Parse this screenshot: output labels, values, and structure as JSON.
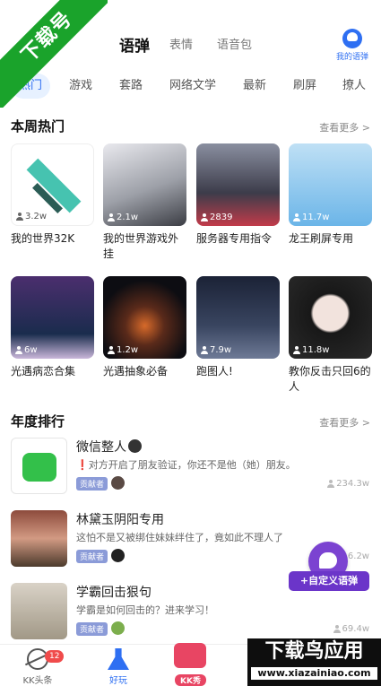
{
  "watermark": {
    "ribbon": "下载号",
    "brand": "下载鸟应用",
    "url": "www.xiazainiao.com"
  },
  "header": {
    "tabs": [
      {
        "label": "语弹"
      },
      {
        "label": "表情"
      },
      {
        "label": "语音包"
      }
    ],
    "mine_label": "我的语弹"
  },
  "categories": [
    {
      "label": "热门"
    },
    {
      "label": "游戏"
    },
    {
      "label": "套路"
    },
    {
      "label": "网络文学"
    },
    {
      "label": "最新"
    },
    {
      "label": "刷屏"
    },
    {
      "label": "撩人"
    }
  ],
  "weekly": {
    "title": "本周热门",
    "more": "查看更多 >",
    "cards": [
      {
        "count": "3.2w",
        "title": "我的世界32K"
      },
      {
        "count": "2.1w",
        "title": "我的世界游戏外挂"
      },
      {
        "count": "2839",
        "title": "服务器专用指令"
      },
      {
        "count": "11.7w",
        "title": "龙王刷屏专用"
      },
      {
        "count": "6w",
        "title": "光遇病恋合集"
      },
      {
        "count": "1.2w",
        "title": "光遇抽象必备"
      },
      {
        "count": "7.9w",
        "title": "跑图人!"
      },
      {
        "count": "11.8w",
        "title": "教你反击只回6的人"
      }
    ]
  },
  "yearly": {
    "title": "年度排行",
    "more": "查看更多 >",
    "items": [
      {
        "title": "微信整人",
        "mark": "❗",
        "desc": "对方开启了朋友验证，你还不是他（她）朋友。",
        "badge": "贡献者",
        "count": "234.3w"
      },
      {
        "title": "林黛玉阴阳专用",
        "mark": "",
        "desc": "这怕不是又被绑住妹妹绊住了，竟如此不理人了",
        "badge": "贡献者",
        "count": "6.2w"
      },
      {
        "title": "学霸回击狠句",
        "mark": "",
        "desc": "学霸是如何回击的？进来学习！",
        "badge": "贡献者",
        "count": "69.4w"
      }
    ]
  },
  "fab": {
    "label": "+自定义语弹"
  },
  "bottom_nav": {
    "items": [
      {
        "label": "KK头条"
      },
      {
        "label": "好玩"
      },
      {
        "label": "KK秀"
      }
    ],
    "unread": "12"
  }
}
